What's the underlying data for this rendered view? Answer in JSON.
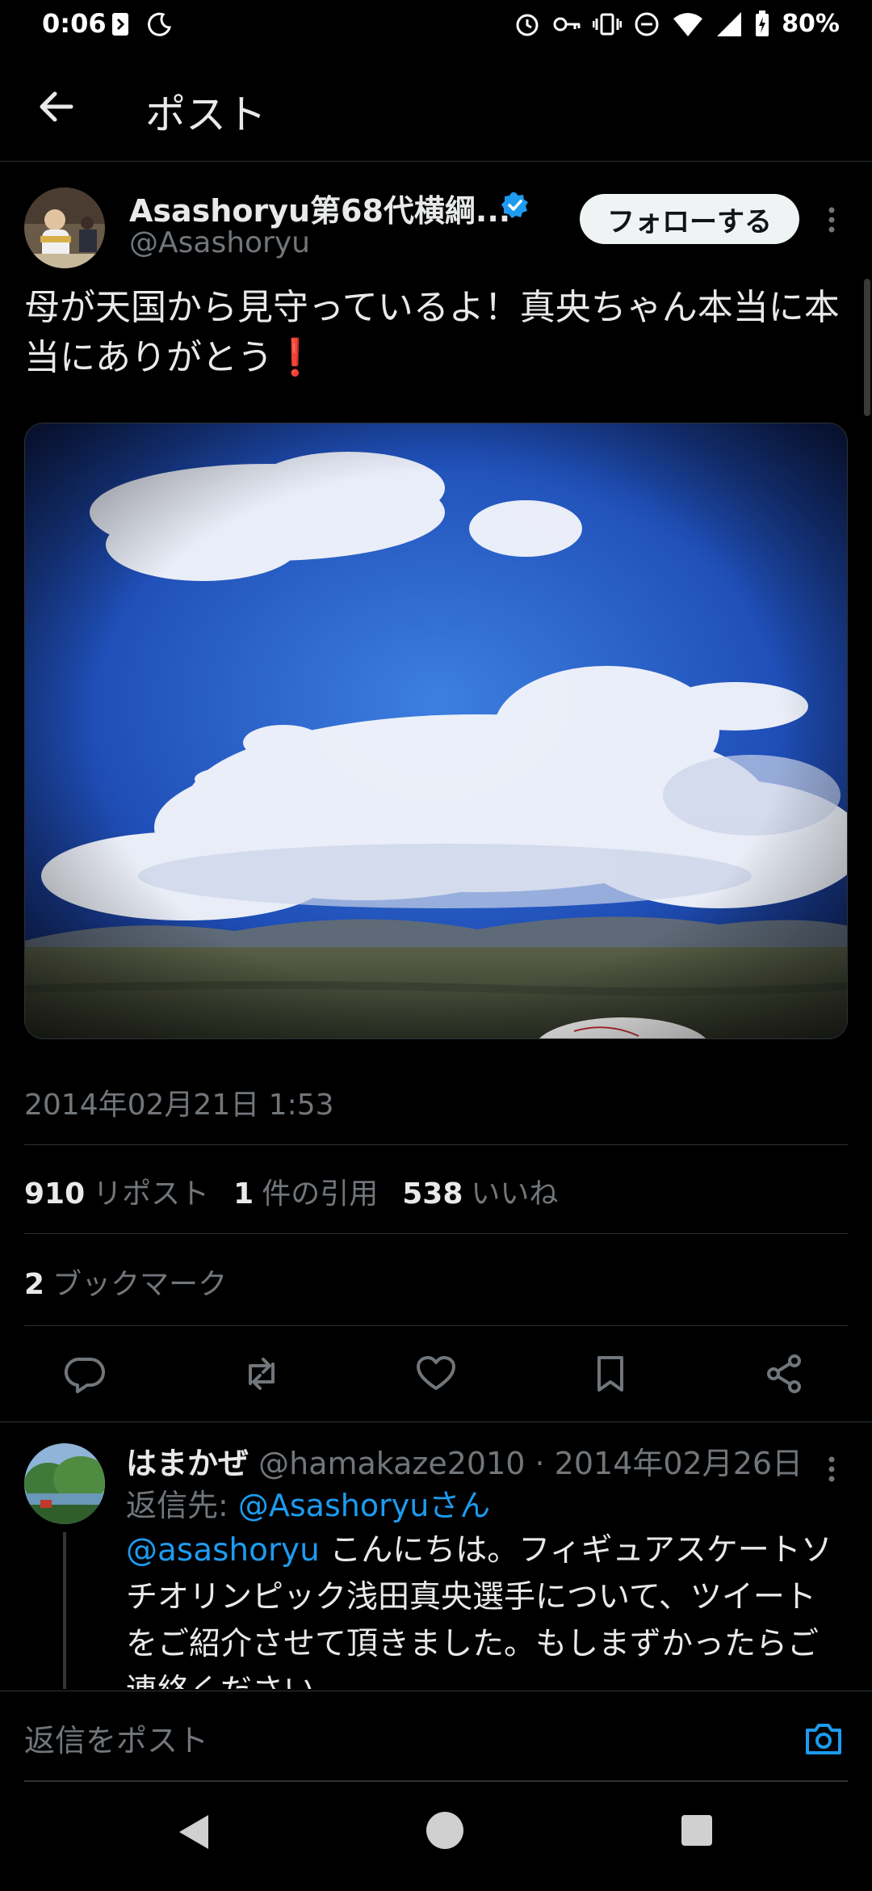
{
  "status_bar": {
    "time": "0:06",
    "battery": "80%"
  },
  "topbar": {
    "title": "ポスト"
  },
  "post": {
    "author_name": "Asashoryu第68代横綱...",
    "author_handle": "@Asashoryu",
    "follow_label": "フォローする",
    "text": "母が天国から見守っているよ！真央ちゃん本当に本当にありがとう",
    "exclamation": "❗",
    "timestamp": "2014年02月21日 1:53",
    "reposts_count": "910",
    "reposts_label": "リポスト",
    "quotes_count": "1",
    "quotes_label": "件の引用",
    "likes_count": "538",
    "likes_label": "いいね",
    "bookmarks_count": "2",
    "bookmarks_label": "ブックマーク"
  },
  "reply": {
    "name": "はまかぜ",
    "meta": "@hamakaze2010 · 2014年02月26日",
    "reply_to_prefix": "返信先: ",
    "reply_to_mention": "@Asashoryuさん",
    "mention": "@asashoryu",
    "body": " こんにちは。フィギュアスケートソチオリンピック浅田真央選手について、ツイートをご紹介させて頂きました。もしまずかったらご連絡ください。"
  },
  "composer": {
    "placeholder": "返信をポスト"
  },
  "colors": {
    "accent": "#1d9bf0",
    "background": "#000000",
    "muted": "#71767b"
  },
  "icons": [
    "back-arrow-icon",
    "verified-badge-icon",
    "more-icon",
    "reply-icon",
    "repost-icon",
    "like-icon",
    "bookmark-icon",
    "share-icon",
    "camera-icon"
  ]
}
